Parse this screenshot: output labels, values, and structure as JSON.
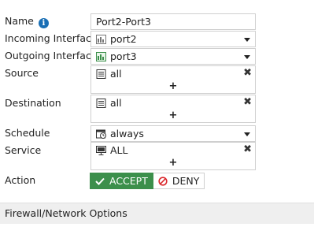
{
  "form": {
    "name": {
      "label": "Name",
      "value": "Port2-Port3"
    },
    "incoming": {
      "label": "Incoming Interface",
      "value": "port2"
    },
    "outgoing": {
      "label": "Outgoing Interface",
      "value": "port3"
    },
    "source": {
      "label": "Source",
      "value": "all",
      "add": "+"
    },
    "destination": {
      "label": "Destination",
      "value": "all",
      "add": "+"
    },
    "schedule": {
      "label": "Schedule",
      "value": "always"
    },
    "service": {
      "label": "Service",
      "value": "ALL",
      "add": "+"
    },
    "action": {
      "label": "Action",
      "accept_label": "ACCEPT",
      "deny_label": "DENY",
      "selected": "ACCEPT"
    }
  },
  "sections": {
    "firewall_options": "Firewall/Network Options"
  },
  "colors": {
    "accept": "#3c8f4b",
    "info": "#1a6fb5",
    "deny_icon": "#d9262b"
  },
  "icons": {
    "name_info": "info-icon",
    "incoming": "port-icon",
    "outgoing": "port-icon-green",
    "address": "address-icon",
    "schedule": "schedule-icon",
    "service": "service-icon",
    "remove": "close-icon",
    "accept": "check-icon",
    "deny": "deny-icon"
  }
}
